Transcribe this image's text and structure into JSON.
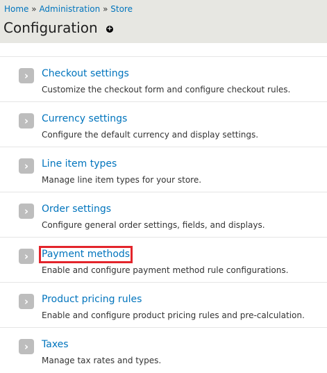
{
  "breadcrumb": {
    "items": [
      "Home",
      "Administration",
      "Store"
    ],
    "separator": "»"
  },
  "page": {
    "title": "Configuration",
    "shortcut_icon": "add-shortcut-icon"
  },
  "items": [
    {
      "title": "Checkout settings",
      "description": "Customize the checkout form and configure checkout rules."
    },
    {
      "title": "Currency settings",
      "description": "Configure the default currency and display settings."
    },
    {
      "title": "Line item types",
      "description": "Manage line item types for your store."
    },
    {
      "title": "Order settings",
      "description": "Configure general order settings, fields, and displays."
    },
    {
      "title": "Payment methods",
      "description": "Enable and configure payment method rule configurations."
    },
    {
      "title": "Product pricing rules",
      "description": "Enable and configure product pricing rules and pre-calculation."
    },
    {
      "title": "Taxes",
      "description": "Manage tax rates and types."
    }
  ],
  "colors": {
    "link": "#0074bd",
    "header_bg": "#e7e7e2",
    "highlight": "#e3242b",
    "arrow_bg": "#bdbdbd"
  }
}
